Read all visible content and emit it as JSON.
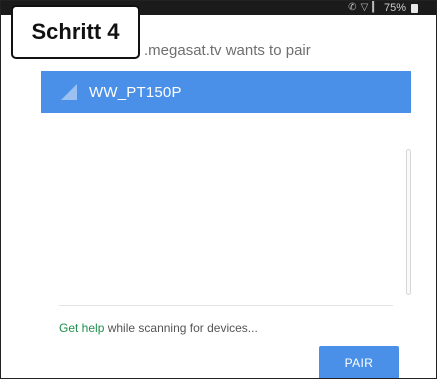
{
  "statusbar": {
    "battery_text": "75%",
    "icons": [
      "phone-icon",
      "wifi-icon",
      "signal-icon",
      "battery-icon"
    ]
  },
  "step_badge": {
    "label": "Schritt 4"
  },
  "dialog": {
    "title": ".megasat.tv wants to pair",
    "devices": [
      {
        "label": "WW_PT150P",
        "icon": "wifi-signal-icon",
        "selected": true
      }
    ],
    "help_link": "Get help",
    "help_rest": " while scanning for devices...",
    "pair_button": "PAIR"
  },
  "colors": {
    "accent": "#4a8fe8",
    "help_link": "#1f8f4d",
    "statusbar": "#1b1b1b"
  }
}
